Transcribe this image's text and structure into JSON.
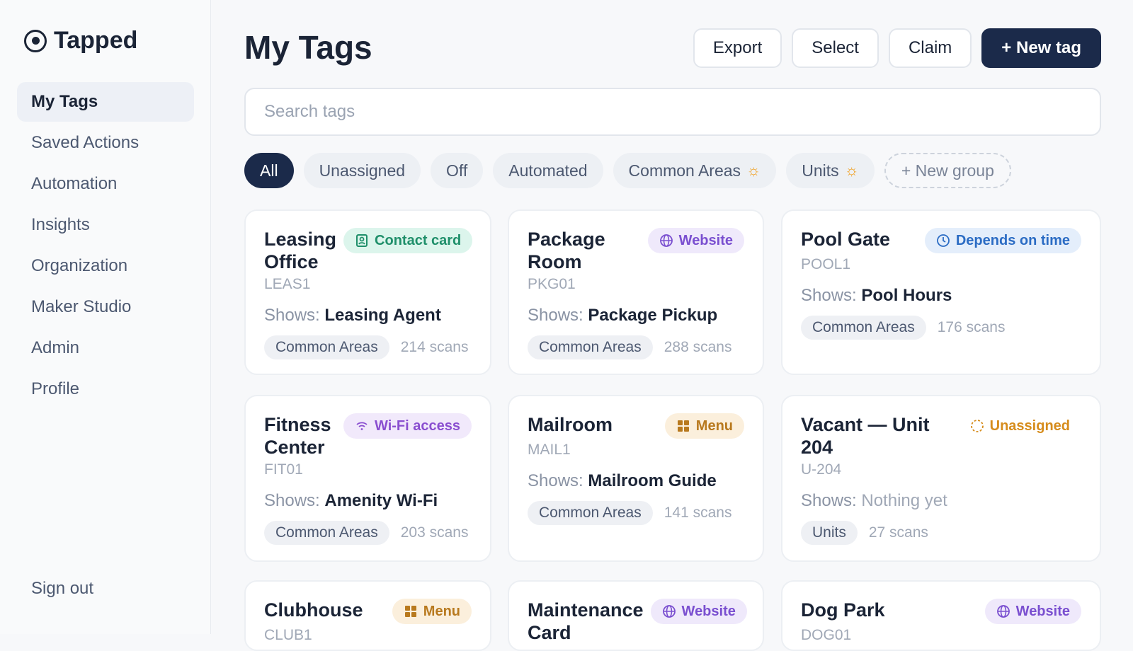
{
  "app": {
    "name": "Tapped"
  },
  "sidebar": {
    "items": [
      {
        "label": "My Tags"
      },
      {
        "label": "Saved Actions"
      },
      {
        "label": "Automation"
      },
      {
        "label": "Insights"
      },
      {
        "label": "Organization"
      },
      {
        "label": "Maker Studio"
      },
      {
        "label": "Admin"
      },
      {
        "label": "Profile"
      }
    ],
    "signout": "Sign out"
  },
  "header": {
    "title": "My Tags",
    "export": "Export",
    "select": "Select",
    "claim": "Claim",
    "new_tag": "+ New tag"
  },
  "search": {
    "placeholder": "Search tags"
  },
  "filters": [
    "All",
    "Unassigned",
    "Off",
    "Automated",
    "Common Areas",
    "Units",
    "+ New group"
  ],
  "shows_prefix": "Shows:",
  "cards": [
    {
      "title": "Leasing Office",
      "badge": "Contact card",
      "badge_icon": "contact-card-icon",
      "code": "LEAS1",
      "shows": "Leasing Agent",
      "group": "Common Areas",
      "scans": "214 scans"
    },
    {
      "title": "Package Room",
      "badge": "Website",
      "badge_icon": "globe-icon",
      "code": "PKG01",
      "shows": "Package Pickup",
      "group": "Common Areas",
      "scans": "288 scans"
    },
    {
      "title": "Pool Gate",
      "badge": "Depends on time",
      "badge_icon": "clock-icon",
      "code": "POOL1",
      "shows": "Pool Hours",
      "group": "Common Areas",
      "scans": "176 scans"
    },
    {
      "title": "Fitness Center",
      "badge": "Wi-Fi access",
      "badge_icon": "wifi-icon",
      "code": "FIT01",
      "shows": "Amenity Wi-Fi",
      "group": "Common Areas",
      "scans": "203 scans"
    },
    {
      "title": "Mailroom",
      "badge": "Menu",
      "badge_icon": "grid-icon",
      "code": "MAIL1",
      "shows": "Mailroom Guide",
      "group": "Common Areas",
      "scans": "141 scans"
    },
    {
      "title": "Vacant — Unit 204",
      "badge": "Unassigned",
      "badge_icon": "dashed-circle-icon",
      "code": "U-204",
      "shows": "Nothing yet",
      "group": "Units",
      "scans": "27 scans"
    },
    {
      "title": "Clubhouse",
      "badge": "Menu",
      "badge_icon": "grid-icon",
      "code": "CLUB1"
    },
    {
      "title": "Maintenance Card",
      "badge": "Website",
      "badge_icon": "globe-icon"
    },
    {
      "title": "Dog Park",
      "badge": "Website",
      "badge_icon": "globe-icon",
      "code": "DOG01"
    }
  ]
}
